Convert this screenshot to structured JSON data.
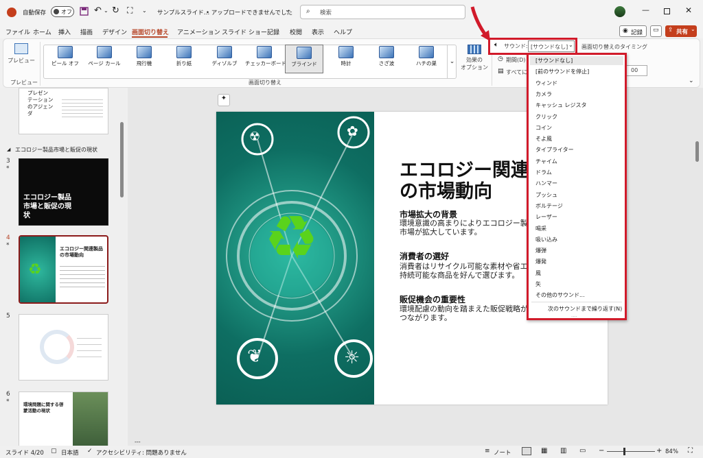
{
  "titlebar": {
    "autosave": "自動保存",
    "toggle": "オフ",
    "doc_title": "サンプルスライド…",
    "upload_status": "• アップロードできませんでした",
    "upload_caret": "⌄",
    "search_placeholder": "検索"
  },
  "menu": [
    "ファイル",
    "ホーム",
    "挿入",
    "描画",
    "デザイン",
    "画面切り替え",
    "アニメーション",
    "スライド ショー",
    "記録",
    "校閲",
    "表示",
    "ヘルプ"
  ],
  "menu_right": {
    "record": "記録",
    "share": "共有"
  },
  "ribbon": {
    "preview": "プレビュー",
    "preview_group": "プレビュー",
    "transitions": [
      "ピール オフ",
      "ページ カール",
      "飛行機",
      "折り紙",
      "ディゾルブ",
      "チェッカーボード",
      "ブラインド",
      "時計",
      "さざ波",
      "ハチの巣"
    ],
    "selected": "ブラインド",
    "effect": [
      "効果の",
      "オプション"
    ],
    "group_label": "画面切り替え",
    "sound_label": "サウンド:",
    "sound_value": "[サウンドなし]",
    "timing_label": "画面切り替えのタイミング",
    "duration_label": "期間(D)",
    "apply_all": "すべてに",
    "spin_value": "00"
  },
  "sound_options": [
    "[サウンドなし]",
    "[前のサウンドを停止]",
    "ウィンド",
    "カメラ",
    "キャッシュ レジスタ",
    "クリック",
    "コイン",
    "そよ風",
    "タイプライター",
    "チャイム",
    "ドラム",
    "ハンマー",
    "プッシュ",
    "ボルテージ",
    "レーザー",
    "喝采",
    "吸い込み",
    "爆弾",
    "爆発",
    "風",
    "矢",
    "その他のサウンド..."
  ],
  "sound_loop": "次のサウンドまで繰り返す(N)",
  "slides_panel": {
    "section": "エコロジー製品市場と販促の現状",
    "slide2": {
      "text": [
        "プレゼン",
        "テーション",
        "のアジェン",
        "ダ"
      ]
    },
    "slide3": {
      "num": "3",
      "title": [
        "エコロジー製品",
        "市場と販促の現",
        "状"
      ]
    },
    "slide4": {
      "num": "4",
      "title": [
        "エコロジー関連製品",
        "の市場動向"
      ]
    },
    "slide5": {
      "num": "5"
    },
    "slide6": {
      "num": "6",
      "title": [
        "環境問題に関する啓",
        "蒙活動の現状"
      ]
    },
    "star": "*"
  },
  "slide": {
    "title_line1": "エコロジー関連",
    "title_line2": "の市場動向",
    "sections": [
      {
        "heading": "市場拡大の背景",
        "lines": [
          "環境意識の高まりによりエコロジー製品の",
          "市場が拡大しています。"
        ]
      },
      {
        "heading": "消費者の選好",
        "lines": [
          "消費者はリサイクル可能な素材や省エネ",
          "持続可能な商品を好んで選びます。"
        ]
      },
      {
        "heading": "販促機会の重要性",
        "lines": [
          "環境配慮の動向を踏まえた販促戦略が",
          "つながります。"
        ]
      }
    ]
  },
  "status": {
    "slide_num": "スライド 4/20",
    "language": "日本語",
    "accessibility": "アクセシビリティ: 問題ありません",
    "notes": "ノート",
    "zoom": "84%",
    "canvas_dash": "---"
  },
  "colors": {
    "accent": "#b7472a",
    "highlight": "#d11a2a",
    "teal": "#0e6e62",
    "recycle": "#5ad31c"
  }
}
